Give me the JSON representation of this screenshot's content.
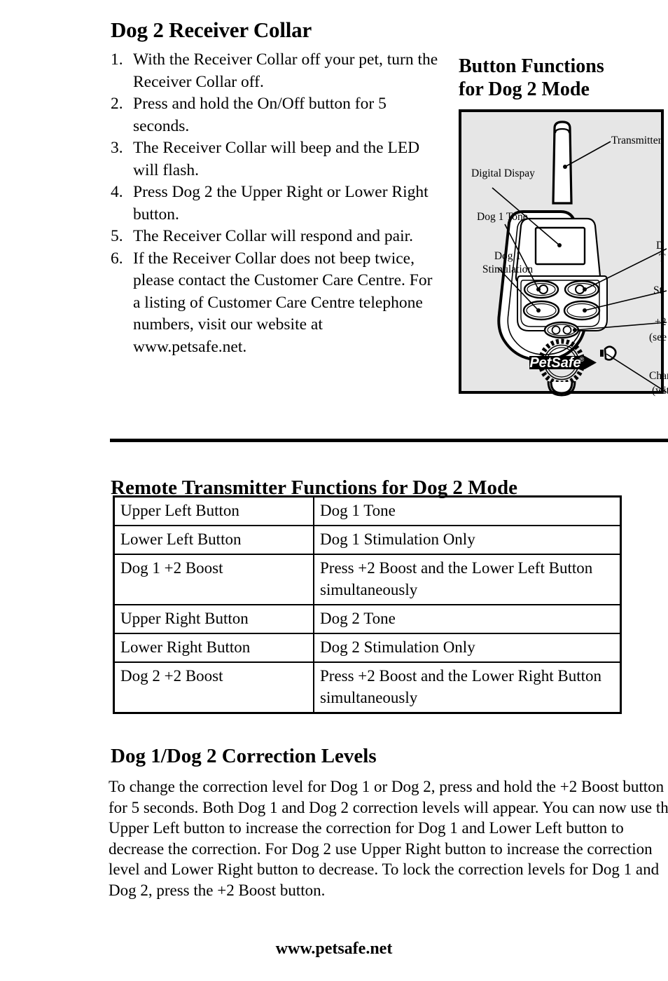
{
  "left": {
    "title": "Dog 2 Receiver Collar",
    "steps": [
      {
        "num": "1.",
        "text": "With the Receiver Collar off your pet, turn the Receiver Collar off."
      },
      {
        "num": "2.",
        "text": "Press and hold the On/Off button for 5 seconds."
      },
      {
        "num": "3.",
        "text": "The Receiver Collar will beep and the LED will flash."
      },
      {
        "num": "4.",
        "text": "Press Dog 2 the Upper Right or Lower Right button."
      },
      {
        "num": "5.",
        "text": "The Receiver Collar will respond and pair."
      },
      {
        "num": "6.",
        "text": "If the Receiver Collar does not beep twice, please contact the Customer Care Centre. For a listing of Customer Care Centre telephone numbers, visit our website at www.petsafe.net."
      }
    ]
  },
  "diagram": {
    "heading_line1": "Button Functions",
    "heading_line2": "for Dog 2 Mode",
    "background_color": "#e6e6e6",
    "border_color": "#000000",
    "logo_text": "PetSafe",
    "callouts": {
      "transmitter": "Transmitter",
      "digital_display": "Digital Dispay",
      "dog1_tone": "Dog 1 Tone",
      "dog1_stimulation_line1": "Dog 1",
      "dog1_stimulation_line2": "Stimulation",
      "right_top_partial": "D",
      "right_top_partial2": "T",
      "stimulation_partial": "St",
      "boost_partial": "+2",
      "boost_note_partial": "(see t",
      "charger_partial": "Char",
      "charger_note_partial": "(wit"
    }
  },
  "table_section": {
    "heading": "Remote Transmitter Functions for Dog 2 Mode",
    "rows": [
      {
        "button": "Upper Left Button",
        "function": "Dog 1 Tone"
      },
      {
        "button": "Lower Left Button",
        "function": "Dog 1 Stimulation Only"
      },
      {
        "button": "Dog 1 +2 Boost",
        "function": "Press +2 Boost and the Lower Left Button simultaneously"
      },
      {
        "button": "Upper Right Button",
        "function": "Dog 2 Tone"
      },
      {
        "button": "Lower Right Button",
        "function": "Dog 2 Stimulation Only"
      },
      {
        "button": "Dog 2 +2 Boost",
        "function": "Press +2 Boost and the Lower Right Button simultaneously"
      }
    ]
  },
  "correction": {
    "heading": "Dog 1/Dog 2 Correction Levels",
    "paragraph": "To change the correction level for Dog 1 or Dog 2, press and hold the +2 Boost button for 5 seconds. Both Dog 1 and Dog 2 correction levels will appear. You can now use the Upper Left button to increase the correction for Dog 1 and Lower Left button to decrease the correction. For Dog 2 use Upper Right button to increase the correction level and Lower Right button to decrease. To lock the correction levels for Dog 1 and Dog 2, press the +2 Boost button."
  },
  "footer": {
    "url": "www.petsafe.net"
  }
}
